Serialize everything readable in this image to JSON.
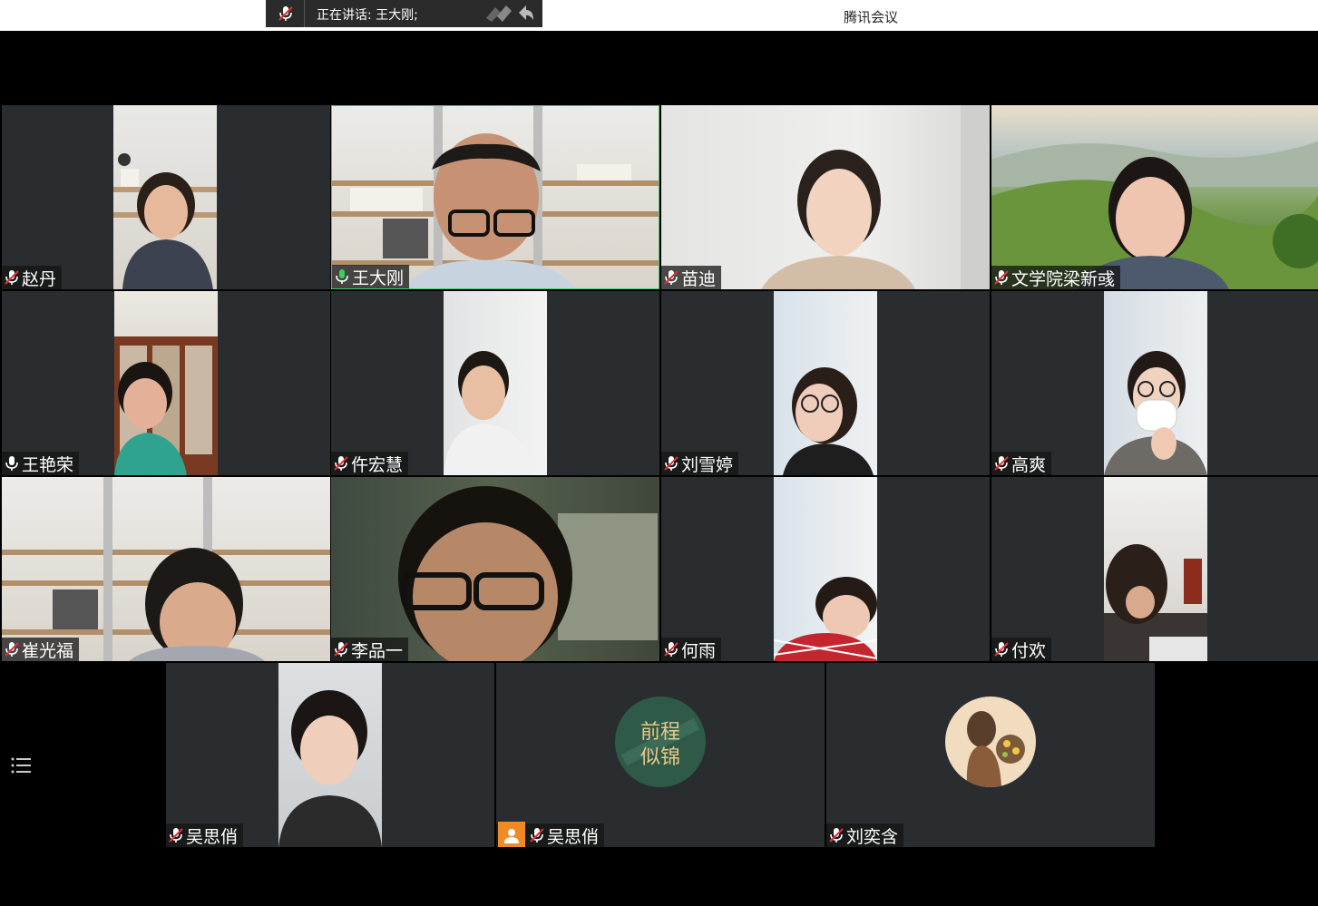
{
  "window": {
    "title": "腾讯会议"
  },
  "speaking_indicator": {
    "label": "正在讲话: 王大刚;"
  },
  "colors": {
    "active_speaker_border": "#3ecf5a",
    "tile_bg": "#2a2d2f",
    "mic_on": "#3ecf5a",
    "mic_muted": "#ffffff",
    "badge": "#f08a24"
  },
  "participants": [
    {
      "name": "赵丹",
      "mic": "muted"
    },
    {
      "name": "王大刚",
      "mic": "speaking"
    },
    {
      "name": "苗迪",
      "mic": "muted"
    },
    {
      "name": "文学院梁新彧",
      "mic": "muted"
    },
    {
      "name": "王艳荣",
      "mic": "on"
    },
    {
      "name": "仵宏慧",
      "mic": "muted"
    },
    {
      "name": "刘雪婷",
      "mic": "muted"
    },
    {
      "name": "高爽",
      "mic": "muted"
    },
    {
      "name": "崔光福",
      "mic": "muted"
    },
    {
      "name": "李品一",
      "mic": "muted"
    },
    {
      "name": "何雨",
      "mic": "muted"
    },
    {
      "name": "付欢",
      "mic": "muted"
    },
    {
      "name": "吴思俏",
      "mic": "muted"
    },
    {
      "name": "吴思俏",
      "mic": "muted"
    },
    {
      "name": "刘奕含",
      "mic": "muted"
    }
  ],
  "avatar_text": {
    "line1": "前程",
    "line2": "似锦"
  }
}
